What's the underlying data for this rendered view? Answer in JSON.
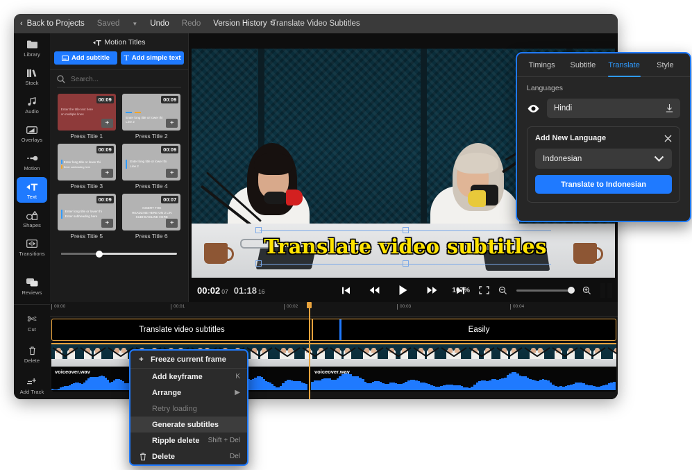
{
  "topbar": {
    "back": "Back to Projects",
    "saved": "Saved",
    "undo": "Undo",
    "redo": "Redo",
    "version_history": "Version History",
    "project_title": "Translate Video Subtitles"
  },
  "rail": {
    "items": [
      {
        "label": "Library",
        "icon": "folder-icon",
        "active": false
      },
      {
        "label": "Stock",
        "icon": "stock-icon",
        "active": false
      },
      {
        "label": "Audio",
        "icon": "audio-icon",
        "active": false
      },
      {
        "label": "Overlays",
        "icon": "overlays-icon",
        "active": false
      },
      {
        "label": "Motion",
        "icon": "motion-icon",
        "active": false
      },
      {
        "label": "Text",
        "icon": "text-icon",
        "active": true
      },
      {
        "label": "Shapes",
        "icon": "shapes-icon",
        "active": false
      },
      {
        "label": "Transitions",
        "icon": "transitions-icon",
        "active": false
      }
    ],
    "reviews": {
      "label": "Reviews",
      "icon": "reviews-icon"
    },
    "tools": [
      {
        "label": "Cut",
        "icon": "scissors-icon"
      },
      {
        "label": "Delete",
        "icon": "trash-icon"
      },
      {
        "label": "Add Track",
        "icon": "add-track-icon"
      }
    ]
  },
  "panel": {
    "header": "Motion Titles",
    "add_subtitle": "Add subtitle",
    "add_simple_text": "Add simple text",
    "search_placeholder": "Search...",
    "cards": [
      {
        "label": "Press Title 1",
        "duration": "00:09",
        "bg": "#8e3a3a",
        "lines": [
          "Enter the title text here",
          "on multiple lines"
        ],
        "style": "plain-red"
      },
      {
        "label": "Press Title 2",
        "duration": "00:09",
        "bg": "#b3b3b3",
        "lines": [
          "Enter long title or lower thi",
          "Line 2"
        ],
        "style": "two-bars"
      },
      {
        "label": "Press Title 3",
        "duration": "00:09",
        "bg": "#b3b3b3",
        "lines": [
          "Enter long title or lower thi",
          "Enter subheading here"
        ],
        "style": "bars-left"
      },
      {
        "label": "Press Title 4",
        "duration": "00:09",
        "bg": "#b3b3b3",
        "lines": [
          "Enter long title or lower thi",
          "Line 2"
        ],
        "style": "bar-blue"
      },
      {
        "label": "Press Title 5",
        "duration": "00:09",
        "bg": "#b3b3b3",
        "lines": [
          "Enter long title or lower thi",
          "Enter subheading here"
        ],
        "style": "bar-blue"
      },
      {
        "label": "Press Title 6",
        "duration": "00:07",
        "bg": "#b3b3b3",
        "lines": [
          "INSERT THE",
          "HEADLINE HERE ON 2 LIN",
          "SUBHEADLINE HERE"
        ],
        "style": "centered"
      }
    ]
  },
  "preview": {
    "subtitle_text": "Translate video subtitles",
    "subtitle_color": "#FFE300"
  },
  "player": {
    "current_time": "00:02",
    "current_frames": "07",
    "total_time": "01:18",
    "total_frames": "16",
    "zoom_level": "107%",
    "buttons": [
      "skip-start-icon",
      "rewind-icon",
      "play-icon",
      "fast-forward-icon",
      "skip-end-icon"
    ],
    "fullscreen_icon": "fit-screen-icon",
    "zoom_out_icon": "zoom-out-icon",
    "zoom_in_icon": "zoom-in-icon",
    "pause_icon": "pause-icon"
  },
  "timeline": {
    "ruler_ticks": [
      "00:00",
      "00:01",
      "00:02",
      "00:03",
      "00:04"
    ],
    "subtitle_clips": [
      {
        "text": "Translate video subtitles"
      },
      {
        "text": "Easily"
      }
    ],
    "audio_clips": [
      {
        "name": "voiceover.wav"
      },
      {
        "name": "voiceover.wav"
      }
    ]
  },
  "translate": {
    "tabs": [
      {
        "label": "Timings",
        "active": false
      },
      {
        "label": "Subtitle",
        "active": false
      },
      {
        "label": "Translate",
        "active": true
      },
      {
        "label": "Style",
        "active": false
      }
    ],
    "section_title": "Languages",
    "current_language": "Hindi",
    "eye_icon": "eye-icon",
    "download_icon": "download-icon",
    "add_new_title": "Add New Language",
    "close_icon": "close-icon",
    "selected_new_language": "Indonesian",
    "chevron_icon": "chevron-down-icon",
    "translate_button": "Translate to Indonesian",
    "accent": "#1f7aff"
  },
  "context_menu": {
    "items": [
      {
        "label": "Freeze current frame",
        "shortcut": "",
        "icon": "plus-icon",
        "state": "normal",
        "arrow": false
      },
      {
        "label": "Add keyframe",
        "shortcut": "K",
        "icon": "",
        "state": "normal",
        "arrow": false
      },
      {
        "label": "Arrange",
        "shortcut": "",
        "icon": "",
        "state": "normal",
        "arrow": true
      },
      {
        "label": "Retry loading",
        "shortcut": "",
        "icon": "",
        "state": "disabled",
        "arrow": false
      },
      {
        "label": "Generate subtitles",
        "shortcut": "",
        "icon": "",
        "state": "highlighted",
        "arrow": false
      },
      {
        "label": "Ripple delete",
        "shortcut": "Shift + Del",
        "icon": "",
        "state": "normal",
        "arrow": false
      },
      {
        "label": "Delete",
        "shortcut": "Del",
        "icon": "trash-icon",
        "state": "normal",
        "arrow": false
      }
    ]
  }
}
